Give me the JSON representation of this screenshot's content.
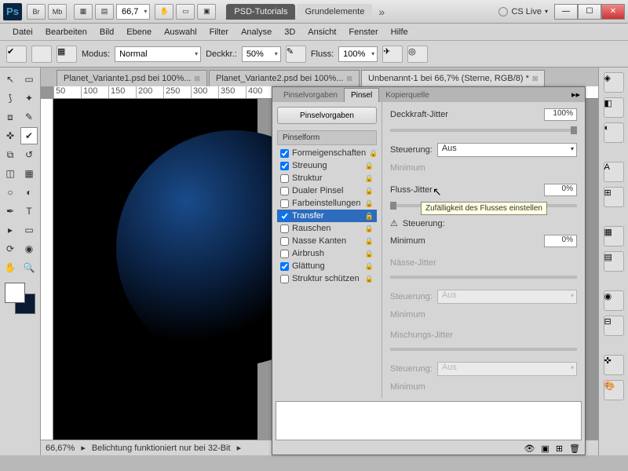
{
  "title": {
    "zoom": "66,7",
    "tabs": [
      "PSD-Tutorials",
      "Grundelemente"
    ],
    "cslive": "CS Live"
  },
  "menu": [
    "Datei",
    "Bearbeiten",
    "Bild",
    "Ebene",
    "Auswahl",
    "Filter",
    "Analyse",
    "3D",
    "Ansicht",
    "Fenster",
    "Hilfe"
  ],
  "options": {
    "modus_label": "Modus:",
    "modus_value": "Normal",
    "deckkr_label": "Deckkr.:",
    "deckkr_value": "50%",
    "fluss_label": "Fluss:",
    "fluss_value": "100%"
  },
  "doc_tabs": [
    {
      "label": "Planet_Variante1.psd bei 100%..."
    },
    {
      "label": "Planet_Variante2.psd bei 100%..."
    },
    {
      "label": "Unbenannt-1 bei 66,7% (Sterne, RGB/8) *",
      "active": true
    }
  ],
  "ruler": [
    "50",
    "100",
    "150",
    "200",
    "250",
    "300",
    "350",
    "400"
  ],
  "status": {
    "zoom": "66,67%",
    "msg": "Belichtung funktioniert nur bei 32-Bit"
  },
  "panel": {
    "tabs": [
      "Pinselvorgaben",
      "Pinsel",
      "Kopierquelle"
    ],
    "preset_btn": "Pinselvorgaben",
    "head": "Pinselform",
    "items": [
      {
        "label": "Formeigenschaften",
        "checked": true
      },
      {
        "label": "Streuung",
        "checked": true
      },
      {
        "label": "Struktur",
        "checked": false
      },
      {
        "label": "Dualer Pinsel",
        "checked": false
      },
      {
        "label": "Farbeinstellungen",
        "checked": false
      },
      {
        "label": "Transfer",
        "checked": true,
        "selected": true
      },
      {
        "label": "Rauschen",
        "checked": false
      },
      {
        "label": "Nasse Kanten",
        "checked": false
      },
      {
        "label": "Airbrush",
        "checked": false
      },
      {
        "label": "Glättung",
        "checked": true
      },
      {
        "label": "Struktur schützen",
        "checked": false
      }
    ],
    "right": {
      "deckkraft_jitter": "Deckkraft-Jitter",
      "deckkraft_val": "100%",
      "steuerung": "Steuerung:",
      "aus": "Aus",
      "minimum": "Minimum",
      "fluss_jitter": "Fluss-Jitter",
      "fluss_val": "0%",
      "fluss_min_val": "0%",
      "naesse": "Nässe-Jitter",
      "mischung": "Mischungs-Jitter"
    },
    "tooltip": "Zufälligkeit des Flusses einstellen"
  }
}
